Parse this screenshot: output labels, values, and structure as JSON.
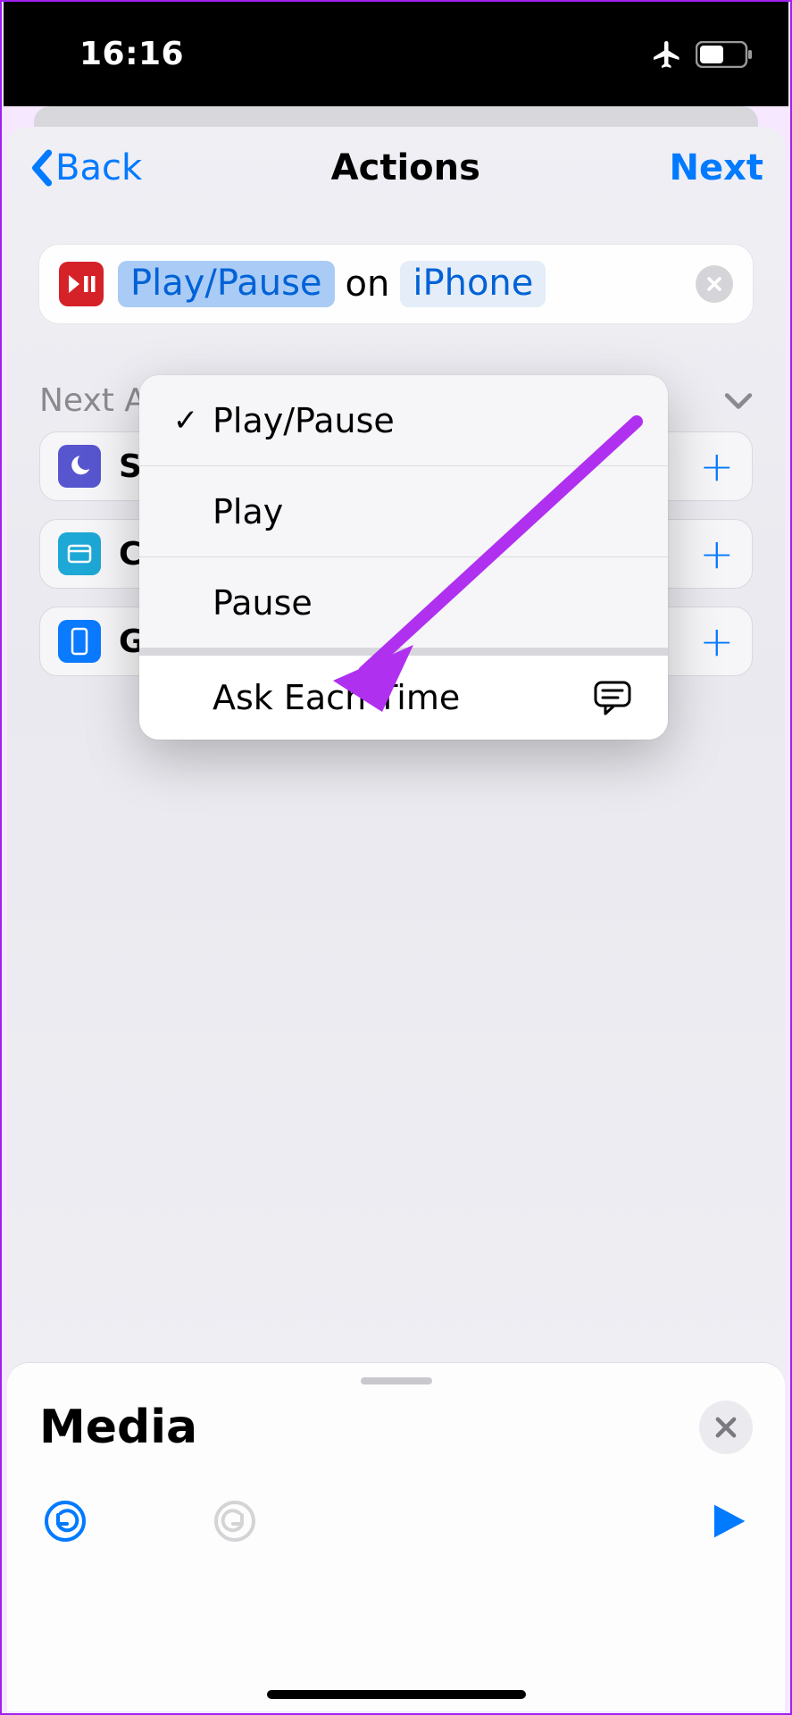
{
  "status": {
    "time": "16:16"
  },
  "nav": {
    "back": "Back",
    "title": "Actions",
    "next": "Next"
  },
  "action": {
    "param1": "Play/Pause",
    "on": "on",
    "param2": "iPhone"
  },
  "popup": {
    "items": [
      {
        "label": "Play/Pause",
        "checked": true
      },
      {
        "label": "Play",
        "checked": false
      },
      {
        "label": "Pause",
        "checked": false
      }
    ],
    "ask": "Ask Each Time"
  },
  "suggestions": {
    "header": "Next Action Suggestions",
    "items": [
      {
        "label": "Set Focus",
        "icon": "moon",
        "bg": "#5856cf"
      },
      {
        "label": "Choose from Menu",
        "icon": "menu",
        "bg": "#1ea8d6"
      },
      {
        "label": "Get Device Details",
        "icon": "phone",
        "bg": "#0a7aff"
      }
    ]
  },
  "panel": {
    "title": "Media"
  },
  "colors": {
    "accent": "#007aff",
    "arrow": "#b030f0"
  }
}
